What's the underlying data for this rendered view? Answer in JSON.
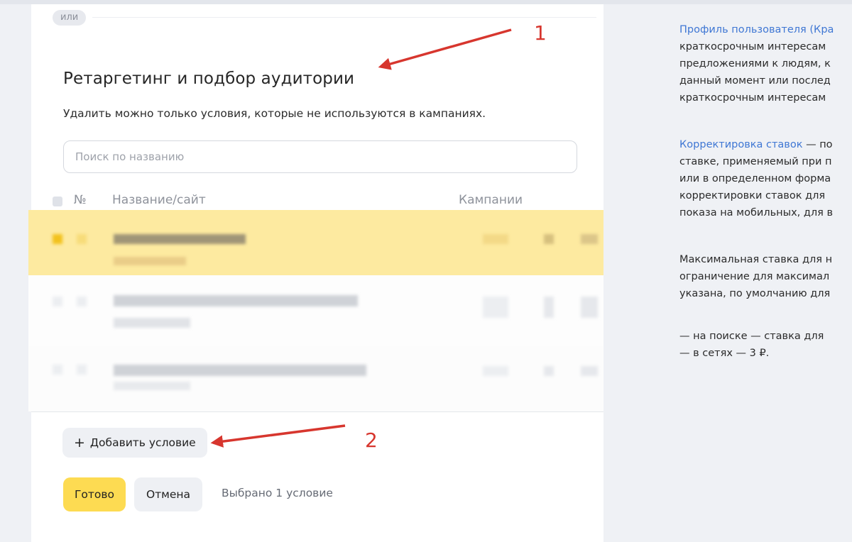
{
  "divider_pill": "или",
  "section": {
    "title": "Ретаргетинг и подбор аудитории",
    "subtitle": "Удалить можно только условия, которые не используются в кампаниях."
  },
  "search": {
    "placeholder": "Поиск по названию",
    "value": ""
  },
  "table": {
    "columns": [
      "№",
      "Название/сайт",
      "Кампании"
    ],
    "rows": [
      {
        "selected": true
      },
      {
        "selected": false
      },
      {
        "selected": false
      }
    ]
  },
  "buttons": {
    "add_condition": "Добавить условие",
    "add_icon": "plus-icon",
    "done": "Готово",
    "cancel": "Отмена"
  },
  "selection_status": "Выбрано 1 условие",
  "annotations": {
    "label_1": "1",
    "label_2": "2",
    "color": "#d7362e"
  },
  "colors": {
    "selected_row": "#fdeaa0",
    "primary_button": "#fddb52",
    "link": "#3f77d4"
  },
  "help": {
    "p1_link": "Профиль пользователя (Кра",
    "p1_lines": [
      "краткосрочным интересам",
      "предложениями к людям, к",
      "данный момент или послед",
      "краткосрочным интересам"
    ],
    "p2_link": "Корректировка ставок",
    "p2_first_rest": " — по",
    "p2_lines": [
      "ставке, применяемый при п",
      "или в определенном форма",
      "корректировки ставок для",
      "показа на мобильных, для в"
    ],
    "p3_lines": [
      "Максимальная ставка для н",
      "ограничение для максимал",
      "указана, по умолчанию для"
    ],
    "p4_lines": [
      "—   на поиске — ставка для",
      "—   в сетях — 3 ₽."
    ]
  }
}
